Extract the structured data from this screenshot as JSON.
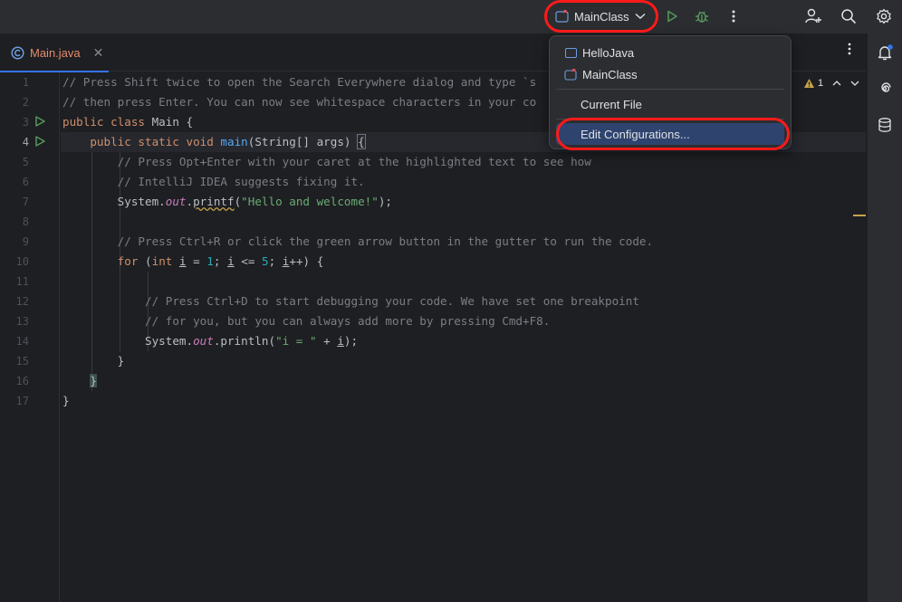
{
  "toolbar": {
    "run_config": "MainClass"
  },
  "tabs": [
    {
      "label": "Main.java"
    }
  ],
  "editor": {
    "line_numbers": [
      "1",
      "2",
      "3",
      "4",
      "5",
      "6",
      "7",
      "8",
      "9",
      "10",
      "11",
      "12",
      "13",
      "14",
      "15",
      "16",
      "17"
    ],
    "comments": {
      "l1": "// Press Shift twice to open the Search Everywhere dialog and type `s",
      "l2": "// then press Enter. You can now see whitespace characters in your co",
      "l5": "// Press Opt+Enter with your caret at the highlighted text to see how",
      "l6": "// IntelliJ IDEA suggests fixing it.",
      "l9": "// Press Ctrl+R or click the green arrow button in the gutter to run the code.",
      "l12": "// Press Ctrl+D to start debugging your code. We have set one breakpoint",
      "l13": "// for you, but you can always add more by pressing Cmd+F8."
    },
    "warning_count": "1"
  },
  "popup": {
    "items": [
      {
        "label": "HelloJava"
      },
      {
        "label": "MainClass"
      },
      {
        "label": "Current File"
      },
      {
        "label": "Edit Configurations..."
      }
    ]
  },
  "colors": {
    "accent": "#3574f0",
    "annotation": "#ff1a1a",
    "selected": "#2e436e"
  }
}
